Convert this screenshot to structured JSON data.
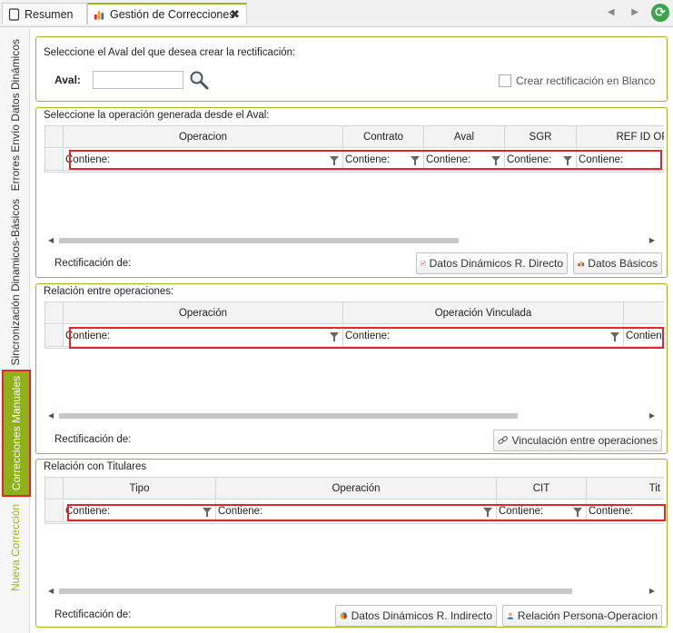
{
  "tabs": [
    {
      "label": "Resumen",
      "icon": "page-icon",
      "active": false
    },
    {
      "label": "Gestión de Correcciones",
      "icon": "chart-icon",
      "active": true,
      "close": "✖"
    }
  ],
  "toolbar": {
    "nav": "◀ ▶",
    "refresh_icon": "refresh-icon"
  },
  "sidebar": {
    "tabs": [
      {
        "label": "Errores Envío Datos Dinámicos"
      },
      {
        "label": "Sincronización Dinamicos-Básicos"
      },
      {
        "label": "Correcciones Manuales",
        "active": true
      },
      {
        "label": "Nueva Corrección"
      }
    ]
  },
  "aval_panel": {
    "title": "Seleccione el Aval del que desea crear la rectificación:",
    "aval_label": "Aval:",
    "aval_value": "",
    "blank_checkbox_label": "Crear rectificación en Blanco",
    "blank_checked": false
  },
  "operations_panel": {
    "title": "Seleccione la operación generada desde el Aval:",
    "columns": [
      "Operacion",
      "Contrato",
      "Aval",
      "SGR",
      "REF ID OP"
    ],
    "filters": [
      "Contiene:",
      "Contiene:",
      "Contiene:",
      "Contiene:",
      "Contiene:"
    ],
    "rect_label": "Rectificación de:",
    "buttons": [
      "Datos Dinámicos R. Directo",
      "Datos Básicos"
    ]
  },
  "relations_panel": {
    "title": "Relación entre operaciones:",
    "columns": [
      "Operación",
      "Operación Vinculada",
      ""
    ],
    "filters": [
      "Contiene:",
      "Contiene:",
      "Contiene:"
    ],
    "rect_label": "Rectificación de:",
    "buttons": [
      "Vinculación entre operaciones"
    ]
  },
  "holders_panel": {
    "title": "Relación con Titulares",
    "columns": [
      "Tipo",
      "Operación",
      "CIT",
      "Tit"
    ],
    "filters": [
      "Contiene:",
      "Contiene:",
      "Contiene:",
      "Contiene:"
    ],
    "rect_label": "Rectificación de:",
    "buttons": [
      "Datos Dinámicos R. Indirecto",
      "Relación Persona-Operacion"
    ]
  },
  "colors": {
    "accent_green": "#9ab81d",
    "active_tab": "#8fb21c",
    "highlight_red": "#e3262b"
  }
}
